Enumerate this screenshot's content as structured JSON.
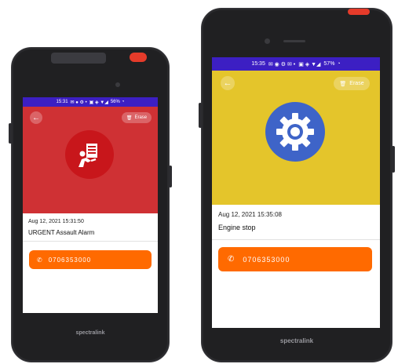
{
  "devices": [
    {
      "status_time": "15:31",
      "status_battery": "56%",
      "hero_color": "#cf3134",
      "erase_label": "Erase",
      "alarm_icon": "person-down-alarm-icon",
      "timestamp": "Aug 12, 2021 15:31:50",
      "title": "URGENT Assault Alarm",
      "phone": "0706353000",
      "brand": "spectralink"
    },
    {
      "status_time": "15:35",
      "status_battery": "57%",
      "hero_color": "#e4c52b",
      "erase_label": "Erase",
      "alarm_icon": "gear-icon",
      "timestamp": "Aug 12, 2021 15:35:08",
      "title": "Engine stop",
      "phone": "0706353000",
      "brand": "spectralink"
    }
  ],
  "colors": {
    "status_bar": "#3c1fc3",
    "call_button": "#ff6a00",
    "alarm_red": "#cf3134",
    "engine_yellow": "#e4c52b",
    "gear_blue": "#3e64c8"
  }
}
